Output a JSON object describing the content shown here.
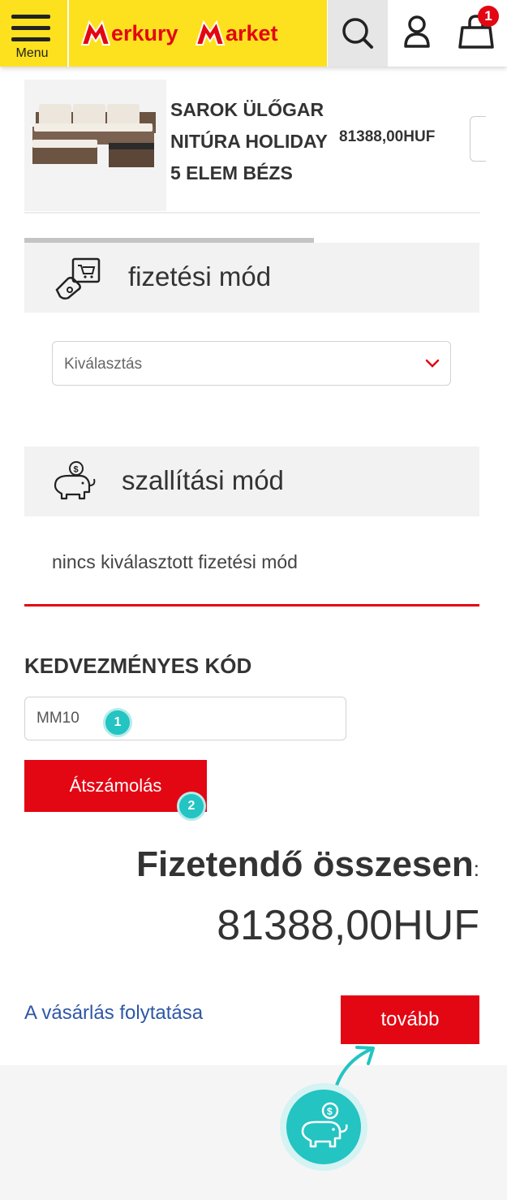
{
  "header": {
    "menu_label": "Menu",
    "logo_text_1": "erkury",
    "logo_text_2": "arket",
    "cart_count": "1"
  },
  "product": {
    "name": "SAROK ÜLŐGAR NITÚRA HOLIDAY 5 ELEM BÉZS",
    "price": "81388,00HUF"
  },
  "payment": {
    "title": "fizetési mód",
    "select_value": "Kiválasztás"
  },
  "shipping": {
    "title": "szallítási mód",
    "message": "nincs kiválasztott fizetési mód"
  },
  "coupon": {
    "title": "KEDVEZMÉNYES KÓD",
    "value": "MM10",
    "button": "Átszámolás"
  },
  "steps": [
    "1",
    "2"
  ],
  "total": {
    "label": "Fizetendő összesen",
    "colon": ":",
    "value": "81388,00HUF"
  },
  "actions": {
    "continue": "A vásárlás folytatása",
    "next": "tovább"
  },
  "colors": {
    "brand_yellow": "#fde11e",
    "accent_red": "#e30613",
    "tutorial_teal": "#23c4c2",
    "link_blue": "#2e57a6"
  }
}
